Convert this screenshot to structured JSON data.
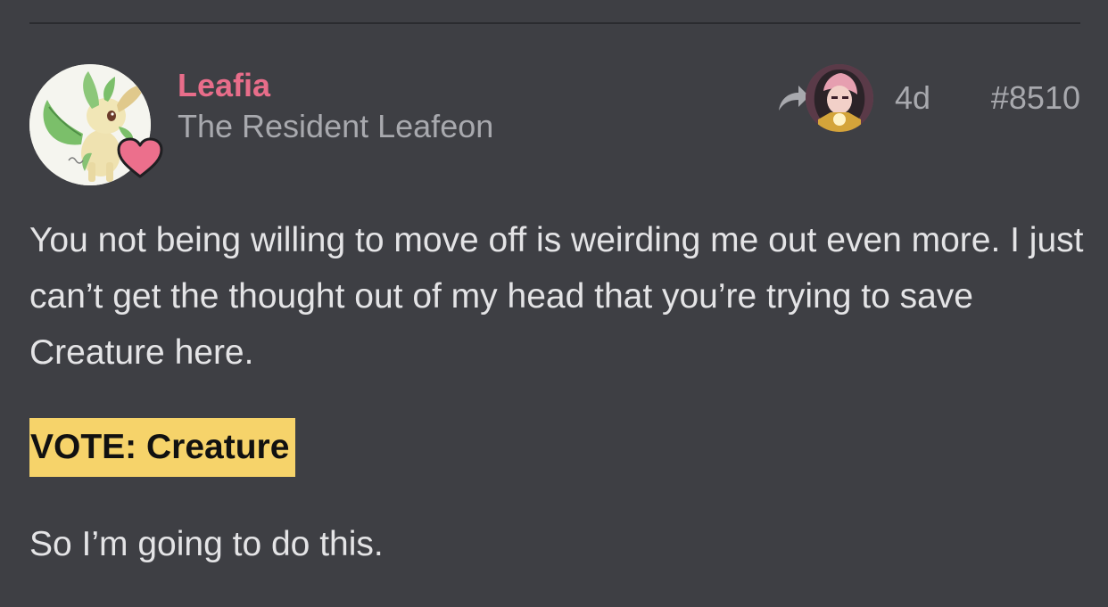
{
  "post": {
    "author": {
      "name": "Leafia",
      "title": "The Resident Leafeon",
      "name_color": "#e86d8a",
      "avatar_icon": "leafeon-avatar",
      "badge_icon": "heart-icon",
      "badge_color": "#ec6f8c"
    },
    "meta": {
      "reply_icon": "reply-arrow-icon",
      "reply_to_avatar": "user-avatar",
      "age": "4d",
      "number": "#8510"
    },
    "body": {
      "paragraph_1": "You not being willing to move off is weirding me out even more. I just can’t get the thought out of my head that you’re trying to save Creature here.",
      "vote": "VOTE: Creature",
      "vote_highlight_color": "#f6d36a",
      "paragraph_3": "So I’m going to do this."
    }
  },
  "colors": {
    "background": "#3e3f44",
    "text": "#e4e4e6",
    "muted_text": "#a8a9ae"
  }
}
